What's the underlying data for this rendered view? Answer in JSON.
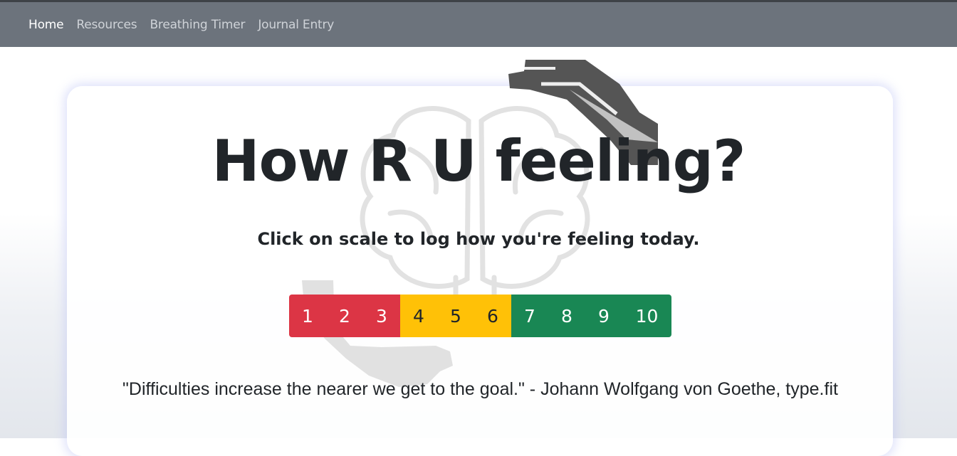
{
  "nav": {
    "items": [
      {
        "label": "Home",
        "active": true
      },
      {
        "label": "Resources",
        "active": false
      },
      {
        "label": "Breathing Timer",
        "active": false
      },
      {
        "label": "Journal Entry",
        "active": false
      }
    ]
  },
  "hero": {
    "title": "How R U feeling?",
    "subtitle": "Click on scale to log how you're feeling today."
  },
  "scale": {
    "buttons": [
      "1",
      "2",
      "3",
      "4",
      "5",
      "6",
      "7",
      "8",
      "9",
      "10"
    ],
    "colors": {
      "low": "#dc3545",
      "mid": "#ffc107",
      "high": "#198754"
    }
  },
  "quote": {
    "text": "\"Difficulties increase the nearer we get to the goal.\" - Johann Wolfgang von Goethe, type.fit"
  },
  "decor": {
    "background_icon": "hands-holding-brain-icon"
  }
}
